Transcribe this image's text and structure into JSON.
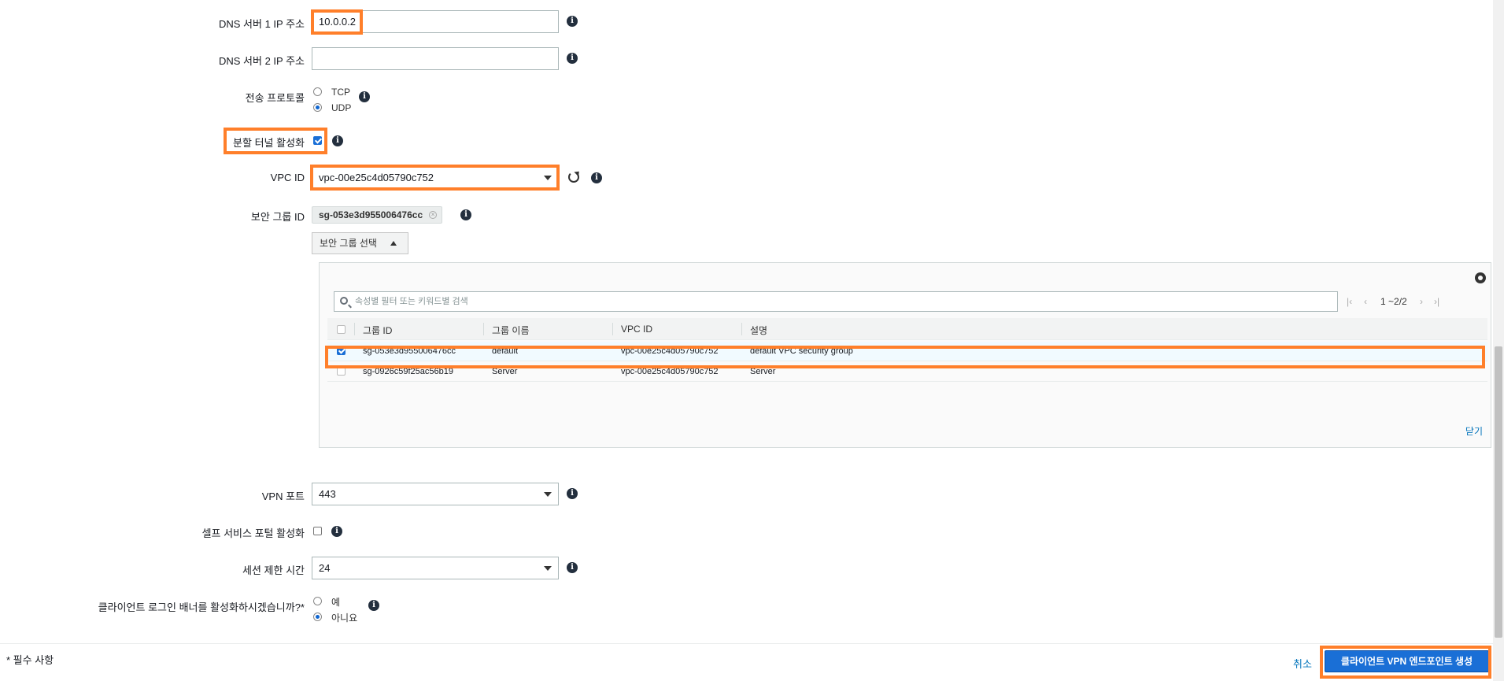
{
  "form": {
    "dns1": {
      "label": "DNS 서버 1 IP 주소",
      "value": "10.0.0.2"
    },
    "dns2": {
      "label": "DNS 서버 2 IP 주소",
      "value": ""
    },
    "protocol": {
      "label": "전송 프로토콜",
      "options": [
        "TCP",
        "UDP"
      ],
      "selected": "UDP"
    },
    "split_tunnel": {
      "label": "분할 터널 활성화",
      "checked": true
    },
    "vpc": {
      "label": "VPC ID",
      "value": "vpc-00e25c4d05790c752"
    },
    "security_group": {
      "label": "보안 그룹 ID",
      "token": "sg-053e3d955006476cc",
      "select_button": "보안 그룹 선택"
    },
    "vpn_port": {
      "label": "VPN 포트",
      "value": "443"
    },
    "self_service": {
      "label": "셀프 서비스 포털 활성화",
      "checked": false
    },
    "session_timeout": {
      "label": "세션 제한 시간",
      "value": "24"
    },
    "banner": {
      "label": "클라이언트 로그인 배너를 활성화하시겠습니까?*",
      "options": [
        "예",
        "아니요"
      ],
      "selected": "아니요"
    }
  },
  "sg_table": {
    "search_placeholder": "속성별 필터 또는 키워드별 검색",
    "pagination": "1 ~2/2",
    "columns": [
      "그룹 ID",
      "그룹 이름",
      "VPC ID",
      "설명"
    ],
    "rows": [
      {
        "id": "sg-053e3d955006476cc",
        "name": "default",
        "vpc": "vpc-00e25c4d05790c752",
        "desc": "default VPC security group",
        "selected": true
      },
      {
        "id": "sg-0926c59f25ac56b19",
        "name": "Server",
        "vpc": "vpc-00e25c4d05790c752",
        "desc": "Server",
        "selected": false
      }
    ],
    "close_label": "닫기"
  },
  "footer": {
    "required_note": "* 필수 사항",
    "cancel_label": "취소",
    "create_label": "클라이언트 VPN 엔드포인트 생성"
  },
  "colors": {
    "highlight": "#ff7f2a",
    "primary": "#1a6fd6",
    "link": "#0073bb"
  }
}
